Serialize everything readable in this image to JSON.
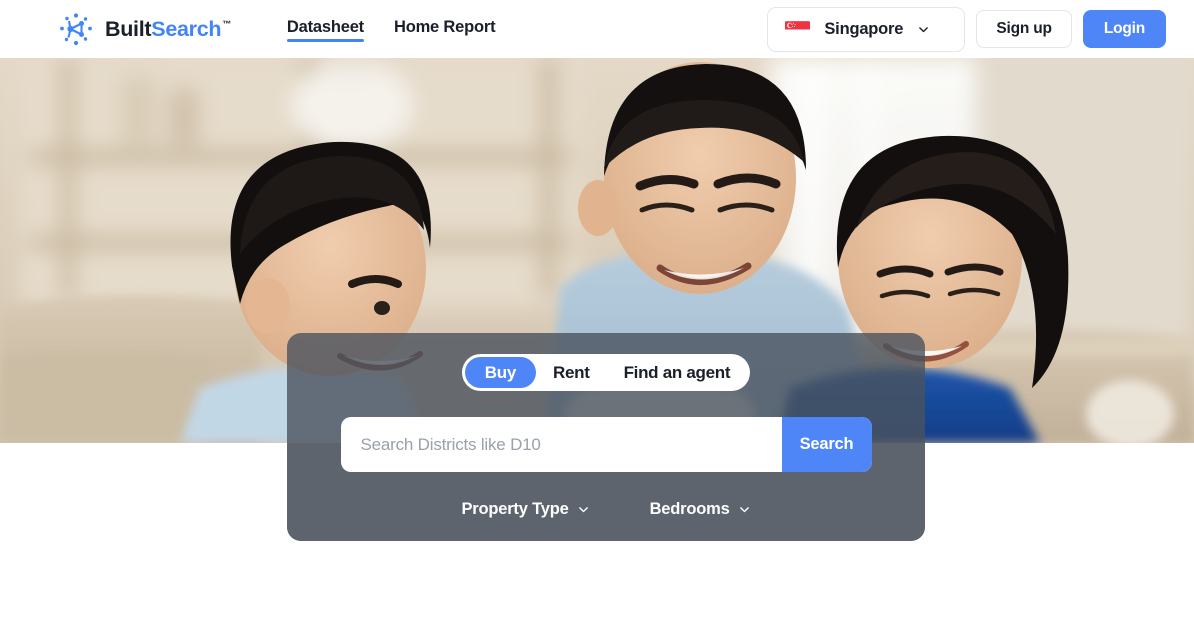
{
  "header": {
    "logo": {
      "icon": "network-nodes-icon",
      "text_primary": "Built",
      "text_accent": "Search",
      "trademark": "™"
    },
    "nav": [
      {
        "label": "Datasheet",
        "active": true
      },
      {
        "label": "Home Report",
        "active": false
      }
    ],
    "country_selector": {
      "flag": "singapore-flag-icon",
      "value": "Singapore",
      "chevron": "chevron-down-icon"
    },
    "signup_label": "Sign up",
    "login_label": "Login"
  },
  "hero": {
    "alt": "family-photo-living-room"
  },
  "search_panel": {
    "tabs": [
      {
        "label": "Buy",
        "active": true
      },
      {
        "label": "Rent",
        "active": false
      },
      {
        "label": "Find an agent",
        "active": false
      }
    ],
    "search": {
      "value": "",
      "placeholder": "Search Districts like D10",
      "button_label": "Search"
    },
    "filters": [
      {
        "label": "Property Type",
        "chevron": "chevron-down-icon"
      },
      {
        "label": "Bedrooms",
        "chevron": "chevron-down-icon"
      }
    ]
  },
  "colors": {
    "accent_blue": "#4f86f7",
    "logo_blue": "#4285f4",
    "text_dark": "#1a1f29",
    "panel_grey": "#5d646e",
    "placeholder_grey": "#9aa1ab",
    "flag_red": "#ef3340"
  }
}
